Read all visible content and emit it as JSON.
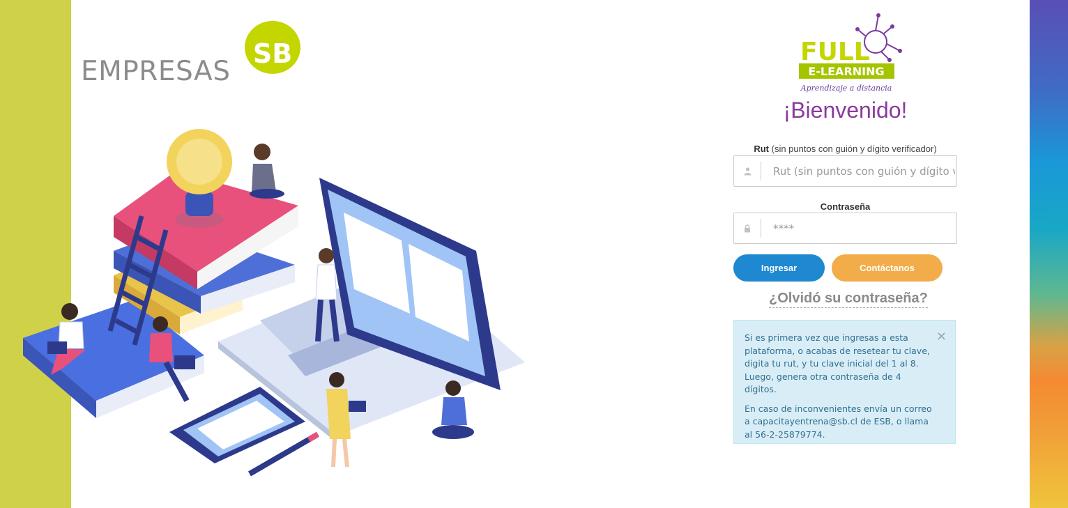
{
  "brand": {
    "company_word": "EMPRESAS",
    "company_circle": "SB",
    "logo_top": "FULL",
    "logo_middle": "E-LEARNING",
    "logo_tagline": "Aprendizaje a distancia"
  },
  "login": {
    "welcome": "¡Bienvenido!",
    "rut_label_bold": "Rut",
    "rut_label_rest": " (sin puntos con guión y dígito verificador)",
    "rut_placeholder": "Rut (sin puntos con guión y dígito verificador)",
    "password_label": "Contraseña",
    "password_placeholder": "****",
    "submit_label": "Ingresar",
    "contact_label": "Contáctanos",
    "forgot_label": "¿Olvidó su contraseña?"
  },
  "notice": {
    "paragraph_1": "Si es primera vez que ingresas a esta plataforma, o acabas de resetear tu clave, digita tu rut, y tu clave inicial del 1 al 8. Luego, genera otra contraseña de 4 dígitos.",
    "paragraph_2": "En caso de inconvenientes envía un correo a capacitayentrena@sb.cl de ESB, o llama al 56-2-25879774.",
    "close_glyph": "×"
  },
  "icons": {
    "user": "user-icon",
    "lock": "lock-icon",
    "close": "close-icon"
  },
  "colors": {
    "left_bar": "#cfd149",
    "brand_green": "#c4d600",
    "welcome_purple": "#8b3a9e",
    "primary_blue": "#1e88d0",
    "contact_orange": "#f2ad4a",
    "alert_bg": "#d9edf7",
    "alert_text": "#31708f"
  }
}
